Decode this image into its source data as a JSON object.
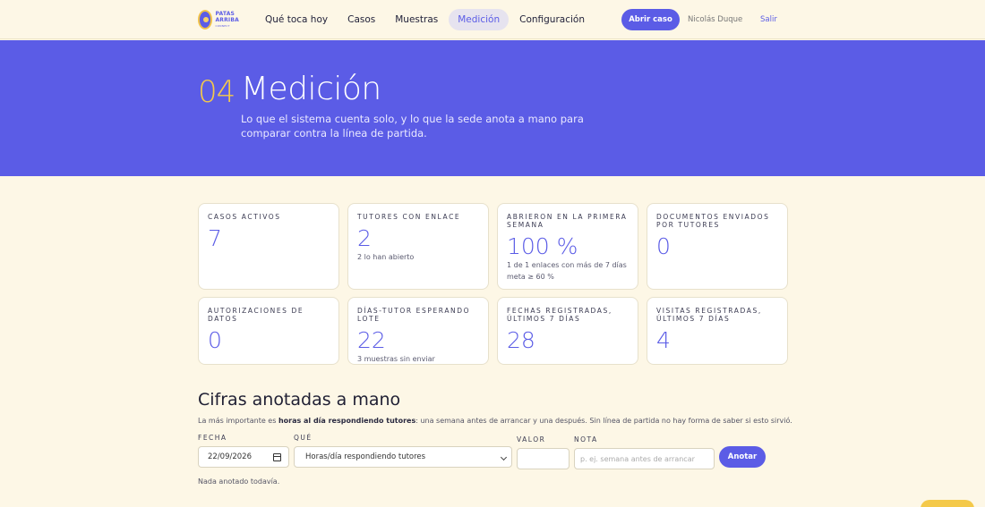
{
  "brand": {
    "line1": "PATAS",
    "line2": "ARRIBA",
    "line3": "CONNECT"
  },
  "nav": {
    "items": [
      {
        "label": "Qué toca hoy"
      },
      {
        "label": "Casos"
      },
      {
        "label": "Muestras"
      },
      {
        "label": "Medición",
        "active": true
      },
      {
        "label": "Configuración"
      }
    ],
    "open_case_label": "Abrir caso",
    "user_name": "Nicolás Duque",
    "logout_label": "Salir"
  },
  "hero": {
    "number": "04",
    "title": "Medición",
    "description": "Lo que el sistema cuenta solo, y lo que la sede anota a mano para comparar contra la línea de partida."
  },
  "cards": [
    {
      "label": "Casos activos",
      "value": "7",
      "sub": ""
    },
    {
      "label": "Tutores con enlace",
      "value": "2",
      "sub": "2 lo han abierto"
    },
    {
      "label": "Abrieron en la primera semana",
      "value": "100 %",
      "sub": "1 de 1 enlaces con más de 7 días",
      "sub2": "meta ≥ 60 %"
    },
    {
      "label": "Documentos enviados por tutores",
      "value": "0",
      "sub": ""
    },
    {
      "label": "Autorizaciones de datos",
      "value": "0",
      "sub": ""
    },
    {
      "label": "Días-tutor esperando lote",
      "value": "22",
      "sub": "3 muestras sin enviar"
    },
    {
      "label": "Fechas registradas, últimos 7 días",
      "value": "28",
      "sub": ""
    },
    {
      "label": "Visitas registradas, últimos 7 días",
      "value": "4",
      "sub": ""
    }
  ],
  "section": {
    "title": "Cifras anotadas a mano",
    "desc_prefix": "La más importante es ",
    "desc_bold": "horas al día respondiendo tutores",
    "desc_suffix": ": una semana antes de arrancar y una después. Sin línea de partida no hay forma de saber si esto sirvió."
  },
  "form": {
    "fecha_label": "Fecha",
    "fecha_value": "22/09/2026",
    "que_label": "Qué",
    "que_value": "Horas/día respondiendo tutores",
    "valor_label": "Valor",
    "valor_value": "",
    "nota_label": "Nota",
    "nota_placeholder": "p. ej. semana antes de arrancar",
    "submit_label": "Anotar"
  },
  "empty_text": "Nada anotado todavía.",
  "colors": {
    "primary": "#5b5ce6",
    "accent": "#f4c94a",
    "background": "#fdf7e6"
  }
}
